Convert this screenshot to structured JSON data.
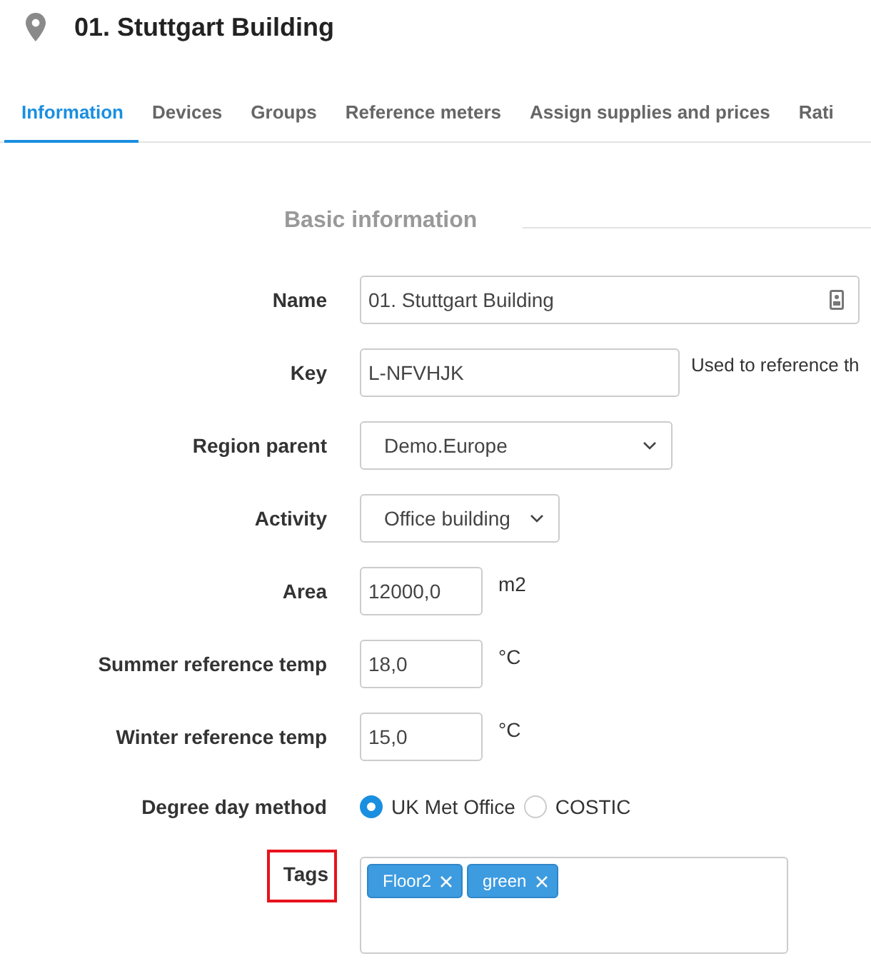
{
  "header": {
    "title": "01. Stuttgart Building"
  },
  "tabs": [
    {
      "label": "Information",
      "selected": true
    },
    {
      "label": "Devices",
      "selected": false
    },
    {
      "label": "Groups",
      "selected": false
    },
    {
      "label": "Reference meters",
      "selected": false
    },
    {
      "label": "Assign supplies and prices",
      "selected": false
    },
    {
      "label": "Rati",
      "selected": false
    }
  ],
  "section": {
    "title": "Basic information"
  },
  "fields": [
    {
      "kind": "text",
      "label": "Name",
      "value": "01. Stuttgart Building"
    },
    {
      "kind": "text",
      "label": "Key",
      "value": "L-NFVHJK",
      "hint": "Used to reference th"
    },
    {
      "kind": "select",
      "label": "Region parent",
      "value": "Demo.Europe"
    },
    {
      "kind": "select",
      "label": "Activity",
      "value": "Office building"
    },
    {
      "kind": "text",
      "label": "Area",
      "value": "12000,0",
      "unit": "m2"
    },
    {
      "kind": "text",
      "label": "Summer reference temp",
      "value": "18,0",
      "unit": "°C"
    },
    {
      "kind": "text",
      "label": "Winter reference temp",
      "value": "15,0",
      "unit": "°C"
    },
    {
      "kind": "radio",
      "label": "Degree day method",
      "options": [
        {
          "label": "UK Met Office",
          "selected": true
        },
        {
          "label": "COSTIC",
          "selected": false
        }
      ]
    },
    {
      "kind": "tags",
      "label": "Tags",
      "highlighted": true,
      "tags": [
        "Floor2",
        "green"
      ]
    }
  ]
}
